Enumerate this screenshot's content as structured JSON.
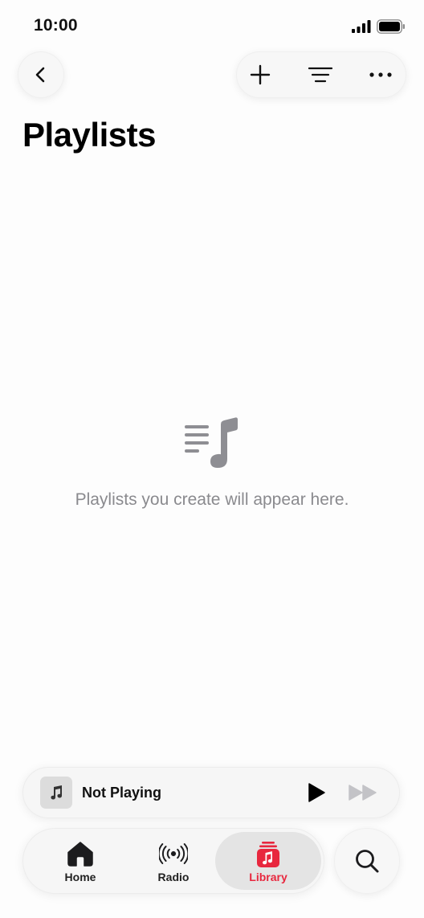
{
  "status_bar": {
    "time": "10:00"
  },
  "header": {
    "title": "Playlists"
  },
  "toolbar": {
    "back_icon": "chevron-left-icon",
    "add_icon": "plus-icon",
    "sort_icon": "sort-lines-icon",
    "more_icon": "ellipsis-icon"
  },
  "empty_state": {
    "icon": "playlist-note-icon",
    "message": "Playlists you create will appear here."
  },
  "mini_player": {
    "title": "Not Playing",
    "artwork_icon": "music-note-icon",
    "play_icon": "play-icon",
    "forward_icon": "fast-forward-icon"
  },
  "tabs": [
    {
      "label": "Home",
      "icon": "home-icon",
      "selected": false
    },
    {
      "label": "Radio",
      "icon": "radio-icon",
      "selected": false
    },
    {
      "label": "Library",
      "icon": "library-icon",
      "selected": true
    }
  ],
  "search": {
    "icon": "search-icon"
  },
  "colors": {
    "accent": "#e8273e",
    "background": "#fdfdfd",
    "secondary_text": "#8a8a8e",
    "disabled_icon": "#c3c3c7"
  }
}
